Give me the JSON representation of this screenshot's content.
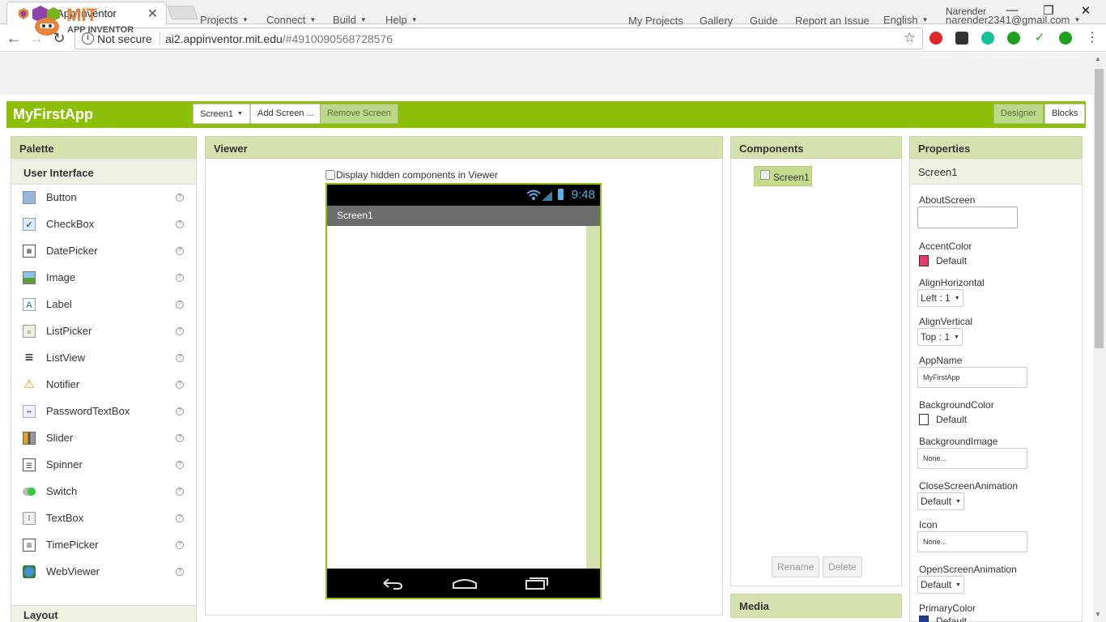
{
  "browser": {
    "tab_title": "MIT App Inventor",
    "tab_close": "✕",
    "user": "Narender",
    "window_controls": {
      "minimize": "—",
      "restore": "❐",
      "close": "✕"
    },
    "nav": {
      "back": "←",
      "forward": "→",
      "reload": "↻"
    },
    "security_label": "Not secure",
    "url_host": "ai2.appinventor.mit.edu",
    "url_path": "/#4910090568728576",
    "extensions": [
      "adblock-icon",
      "extension-icon",
      "grammarly-icon",
      "check-icon",
      "checkmark-icon",
      "leaf-icon"
    ],
    "colors": {
      "adblock": "#e0262a",
      "grammarly": "#15c39a",
      "check": "#1fa01f",
      "leaf": "#1fa01f"
    }
  },
  "header": {
    "logo_top": "MIT",
    "logo_bottom": "APP INVENTOR",
    "menus": [
      "Projects",
      "Connect",
      "Build",
      "Help"
    ],
    "links": [
      "My Projects",
      "Gallery",
      "Guide",
      "Report an Issue"
    ],
    "language": "English",
    "account": "narender2341@gmail.com"
  },
  "project": {
    "name": "MyFirstApp",
    "screen_select": "Screen1",
    "add_screen": "Add Screen ...",
    "remove_screen": "Remove Screen",
    "designer": "Designer",
    "blocks": "Blocks",
    "accent_color": "#8ebf08"
  },
  "palette": {
    "title": "Palette",
    "category": "User Interface",
    "items": [
      {
        "name": "Button",
        "icon": "button-icon"
      },
      {
        "name": "CheckBox",
        "icon": "checkbox-icon"
      },
      {
        "name": "DatePicker",
        "icon": "datepicker-icon"
      },
      {
        "name": "Image",
        "icon": "image-icon"
      },
      {
        "name": "Label",
        "icon": "label-icon"
      },
      {
        "name": "ListPicker",
        "icon": "listpicker-icon"
      },
      {
        "name": "ListView",
        "icon": "listview-icon"
      },
      {
        "name": "Notifier",
        "icon": "notifier-icon"
      },
      {
        "name": "PasswordTextBox",
        "icon": "passwordtextbox-icon"
      },
      {
        "name": "Slider",
        "icon": "slider-icon"
      },
      {
        "name": "Spinner",
        "icon": "spinner-icon"
      },
      {
        "name": "Switch",
        "icon": "switch-icon"
      },
      {
        "name": "TextBox",
        "icon": "textbox-icon"
      },
      {
        "name": "TimePicker",
        "icon": "timepicker-icon"
      },
      {
        "name": "WebViewer",
        "icon": "webviewer-icon"
      }
    ],
    "help_glyph": "?",
    "layout_category": "Layout"
  },
  "viewer": {
    "title": "Viewer",
    "hidden_checkbox_label": "Display hidden components in Viewer",
    "phone_time": "9:48",
    "screen_title": "Screen1"
  },
  "components": {
    "title": "Components",
    "tree": [
      "Screen1"
    ],
    "rename": "Rename",
    "delete": "Delete",
    "media_title": "Media"
  },
  "properties": {
    "title": "Properties",
    "component": "Screen1",
    "about_screen": {
      "label": "AboutScreen",
      "value": ""
    },
    "accent_color": {
      "label": "AccentColor",
      "value": "Default",
      "swatch": "#e9386a"
    },
    "align_horizontal": {
      "label": "AlignHorizontal",
      "value": "Left : 1"
    },
    "align_vertical": {
      "label": "AlignVertical",
      "value": "Top : 1"
    },
    "app_name": {
      "label": "AppName",
      "value": "MyFirstApp"
    },
    "background_color": {
      "label": "BackgroundColor",
      "value": "Default",
      "swatch": "#ffffff"
    },
    "background_image": {
      "label": "BackgroundImage",
      "value": "None..."
    },
    "close_screen_animation": {
      "label": "CloseScreenAnimation",
      "value": "Default"
    },
    "icon": {
      "label": "Icon",
      "value": "None..."
    },
    "open_screen_animation": {
      "label": "OpenScreenAnimation",
      "value": "Default"
    },
    "primary_color": {
      "label": "PrimaryColor",
      "value": "Default",
      "swatch": "#1a3c8e"
    }
  }
}
